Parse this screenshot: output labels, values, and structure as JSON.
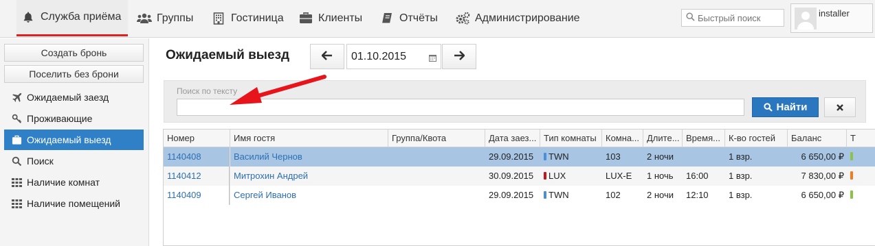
{
  "nav": {
    "items": [
      {
        "label": "Служба приёма",
        "icon": "bell-icon"
      },
      {
        "label": "Группы",
        "icon": "users-icon"
      },
      {
        "label": "Гостиница",
        "icon": "building-icon"
      },
      {
        "label": "Клиенты",
        "icon": "briefcase-icon"
      },
      {
        "label": "Отчёты",
        "icon": "book-icon"
      },
      {
        "label": "Администрирование",
        "icon": "gears-icon"
      }
    ],
    "active": "Служба приёма",
    "active_color": "#e21e1e",
    "quick_search_placeholder": "Быстрый поиск",
    "user": "installer"
  },
  "sidebar": {
    "buttons": [
      "Создать бронь",
      "Поселить без брони"
    ],
    "items": [
      {
        "label": "Ожидаемый заезд",
        "icon": "plane-icon"
      },
      {
        "label": "Проживающие",
        "icon": "key-icon"
      },
      {
        "label": "Ожидаемый выезд",
        "icon": "suitcase-icon"
      },
      {
        "label": "Поиск",
        "icon": "search-icon"
      },
      {
        "label": "Наличие комнат",
        "icon": "grid-icon"
      },
      {
        "label": "Наличие помещений",
        "icon": "grid-icon"
      }
    ],
    "active": "Ожидаемый выезд",
    "active_color": "#2f80c6"
  },
  "main": {
    "title": "Ожидаемый выезд",
    "date": "01.10.2015",
    "search": {
      "label": "Поиск по тексту",
      "value": "",
      "find_label": "Найти",
      "find_color": "#2a77bf"
    }
  },
  "table": {
    "columns": [
      "Номер",
      "Имя гостя",
      "Группа/Квота",
      "Дата заез...",
      "Тип комнаты",
      "Комна...",
      "Длите...",
      "Время...",
      "К-во гостей",
      "Баланс",
      "Т"
    ],
    "rows": [
      {
        "number": "1140408",
        "guest": "Василий Чернов",
        "group": "",
        "arrival": "29.09.2015",
        "room_type": "TWN",
        "type_color": "#4a90d9",
        "room": "103",
        "duration": "2 ночи",
        "time": "",
        "guests": "1 взр.",
        "balance": "6 650,00 ₽",
        "status_color": "#8bc34a",
        "selected": true
      },
      {
        "number": "1140412",
        "guest": "Митрохин Андрей",
        "group": "",
        "arrival": "30.09.2015",
        "room_type": "LUX",
        "type_color": "#c0181f",
        "room": "LUX-E",
        "duration": "1 ночь",
        "time": "16:00",
        "guests": "1 взр.",
        "balance": "7 830,00 ₽",
        "status_color": "#f47c20",
        "selected": false
      },
      {
        "number": "1140409",
        "guest": "Сергей Иванов",
        "group": "",
        "arrival": "29.09.2015",
        "room_type": "TWN",
        "type_color": "#4a90d9",
        "room": "102",
        "duration": "2 ночи",
        "time": "12:10",
        "guests": "1 взр.",
        "balance": "6 650,00 ₽",
        "status_color": "#8bc34a",
        "selected": false
      }
    ]
  },
  "annotation": {
    "type": "arrow",
    "color": "#e8141b"
  }
}
